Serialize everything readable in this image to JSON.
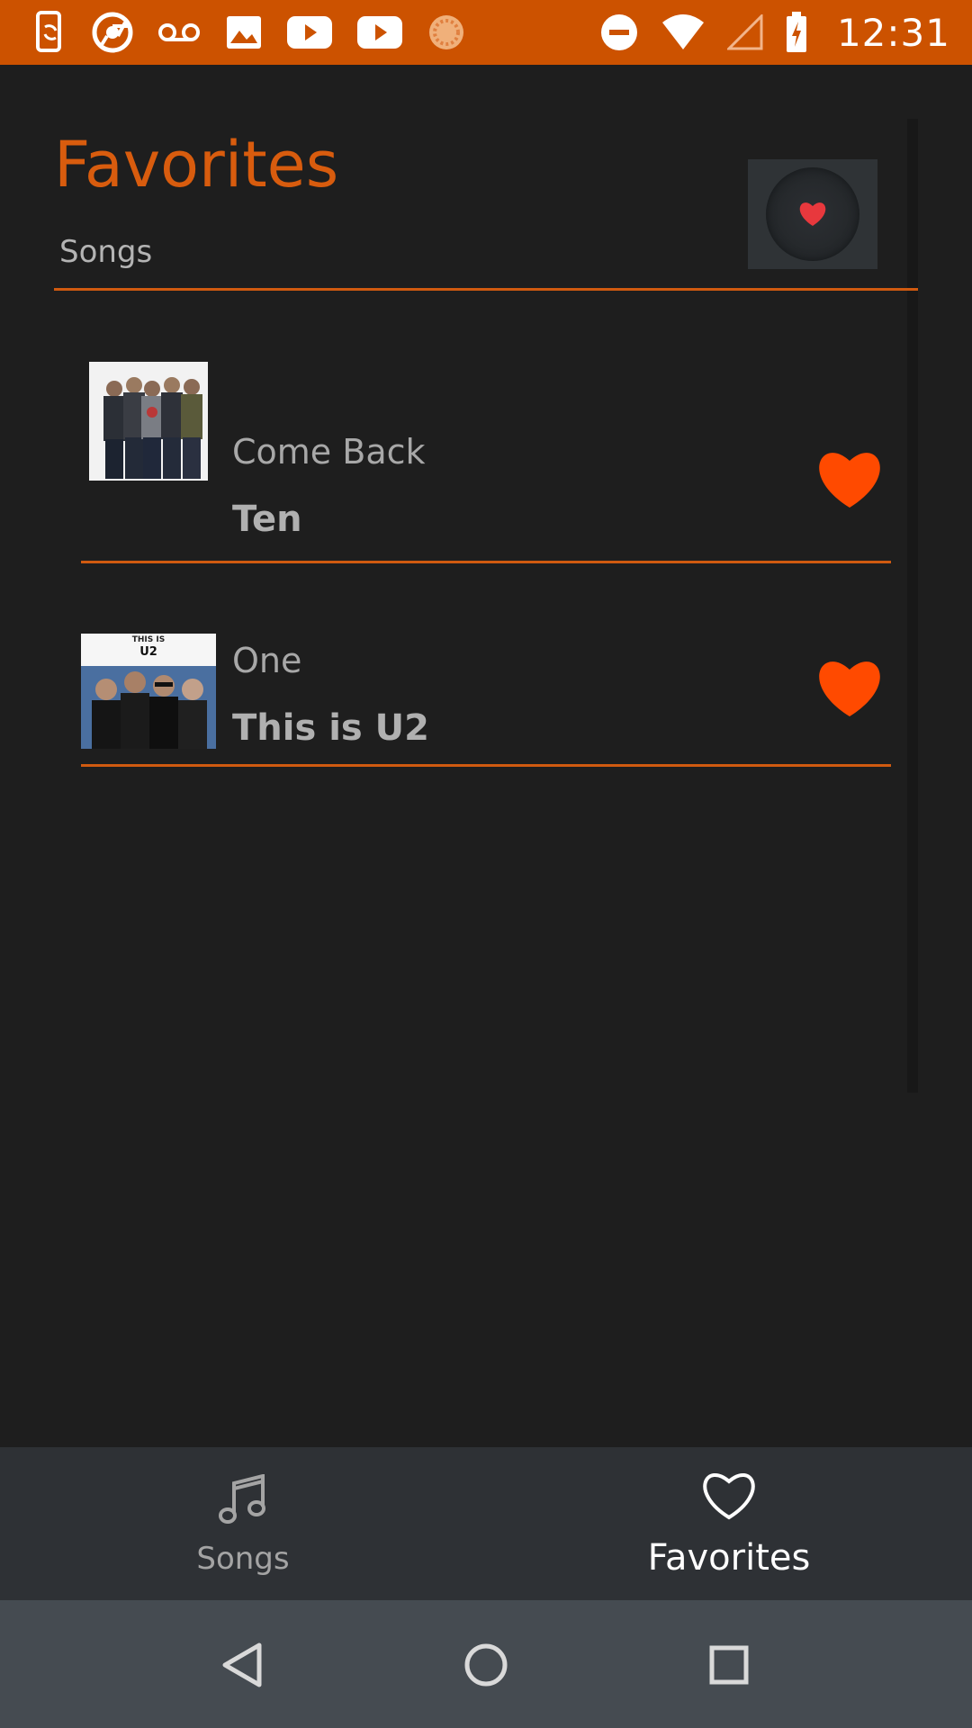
{
  "status_bar": {
    "time": "12:31",
    "left_icons": [
      "phone-sync-icon",
      "chrome-icon",
      "voicemail-icon",
      "image-icon",
      "youtube-icon",
      "youtube-icon",
      "loading-icon"
    ],
    "right_icons": [
      "do-not-disturb-icon",
      "wifi-icon",
      "signal-icon",
      "battery-charging-icon"
    ],
    "background_color": "#cc5200"
  },
  "header": {
    "title": "Favorites",
    "section_label": "Songs",
    "badge_icon": "heart-disc-icon"
  },
  "songs": [
    {
      "title": "Come Back",
      "album": "Ten",
      "favorite": true,
      "art_icon": "band-photo"
    },
    {
      "title": "One",
      "album": "This is U2",
      "favorite": true,
      "art_icon": "band-photo",
      "art_caption_line1": "THIS IS",
      "art_caption_line2": "U2"
    }
  ],
  "bottom_nav": {
    "tabs": [
      {
        "label": "Songs",
        "icon": "music-note-icon",
        "active": false
      },
      {
        "label": "Favorites",
        "icon": "heart-outline-icon",
        "active": true
      }
    ]
  },
  "system_nav": {
    "buttons": [
      "back-icon",
      "home-icon",
      "recents-icon"
    ]
  },
  "colors": {
    "accent": "#d85c0e",
    "heart": "#ff4a00",
    "background": "#1e1e1e",
    "nav_background": "#2e3135",
    "system_nav_background": "#454b51"
  }
}
